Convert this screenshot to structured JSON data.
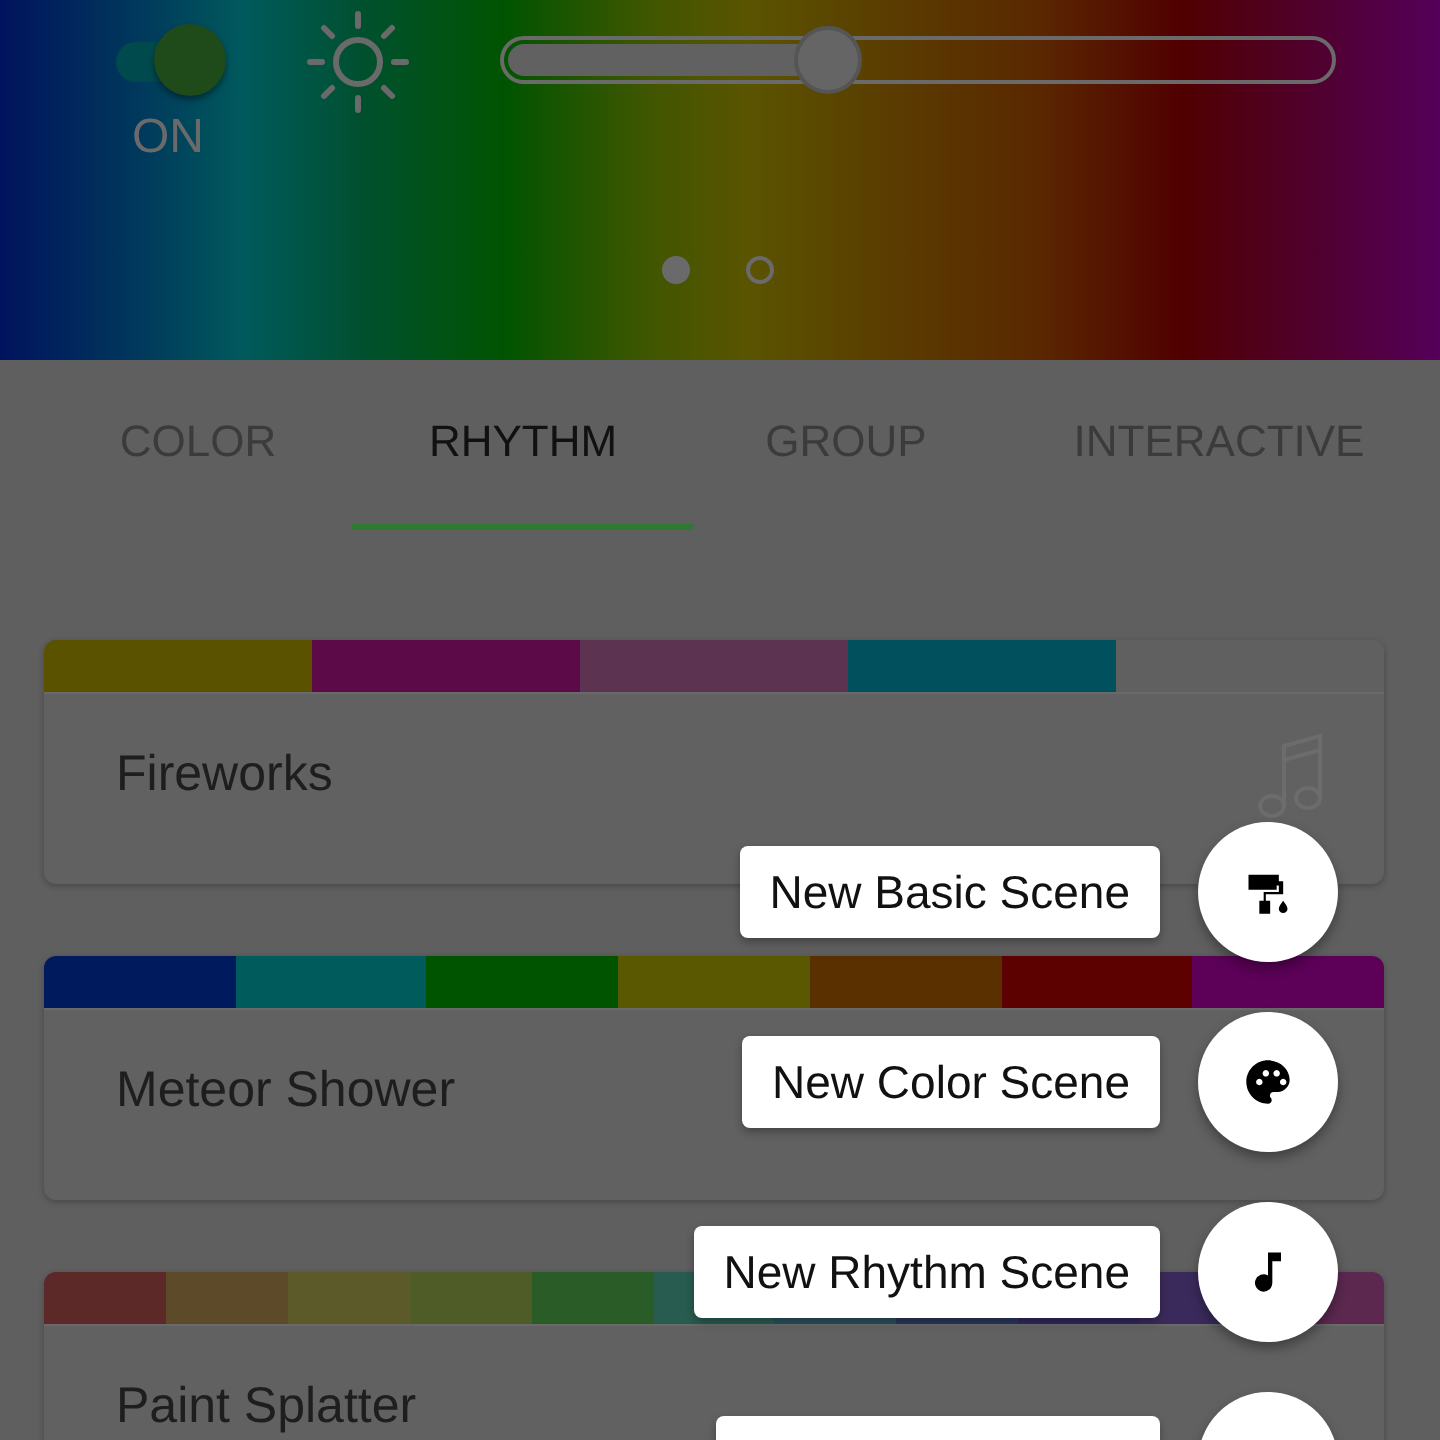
{
  "header": {
    "power": {
      "label": "ON",
      "on": true
    },
    "brightness": {
      "level": 0.39
    },
    "pages": [
      {
        "selected": true
      },
      {
        "selected": false
      }
    ]
  },
  "tabs": [
    {
      "label": "COLOR",
      "selected": false
    },
    {
      "label": "RHYTHM",
      "selected": true
    },
    {
      "label": "GROUP",
      "selected": false
    },
    {
      "label": "INTERACTIVE",
      "selected": false
    }
  ],
  "scenes": [
    {
      "name": "Fireworks",
      "music_icon": true,
      "colors": [
        {
          "color": "#5b5200"
        },
        {
          "color": "#5c0a48"
        },
        {
          "color": "#5c3350"
        },
        {
          "color": "#00505e"
        },
        {
          "color": "#606060"
        }
      ]
    },
    {
      "name": "Meteor Shower",
      "music_icon": false,
      "colors": [
        {
          "color": "#001a5e"
        },
        {
          "color": "#005b5c"
        },
        {
          "color": "#005400"
        },
        {
          "color": "#5a5800"
        },
        {
          "color": "#5a3000"
        },
        {
          "color": "#5c0000"
        },
        {
          "color": "#5c0058"
        }
      ]
    },
    {
      "name": "Paint Splatter",
      "music_icon": false,
      "colors": [
        {
          "color": "#5c2828"
        },
        {
          "color": "#5c4a28"
        },
        {
          "color": "#5c5a28"
        },
        {
          "color": "#505c28"
        },
        {
          "color": "#2a5c28"
        },
        {
          "color": "#285c50"
        },
        {
          "color": "#28505c"
        },
        {
          "color": "#28385c"
        },
        {
          "color": "#30285c"
        },
        {
          "color": "#3a2a5c"
        },
        {
          "color": "#5c2850"
        }
      ]
    }
  ],
  "fab_actions": [
    {
      "kind": "basic",
      "label": "New Basic Scene"
    },
    {
      "kind": "color",
      "label": "New Color Scene"
    },
    {
      "kind": "rhythm",
      "label": "New Rhythm Scene"
    },
    {
      "kind": "partial"
    }
  ]
}
